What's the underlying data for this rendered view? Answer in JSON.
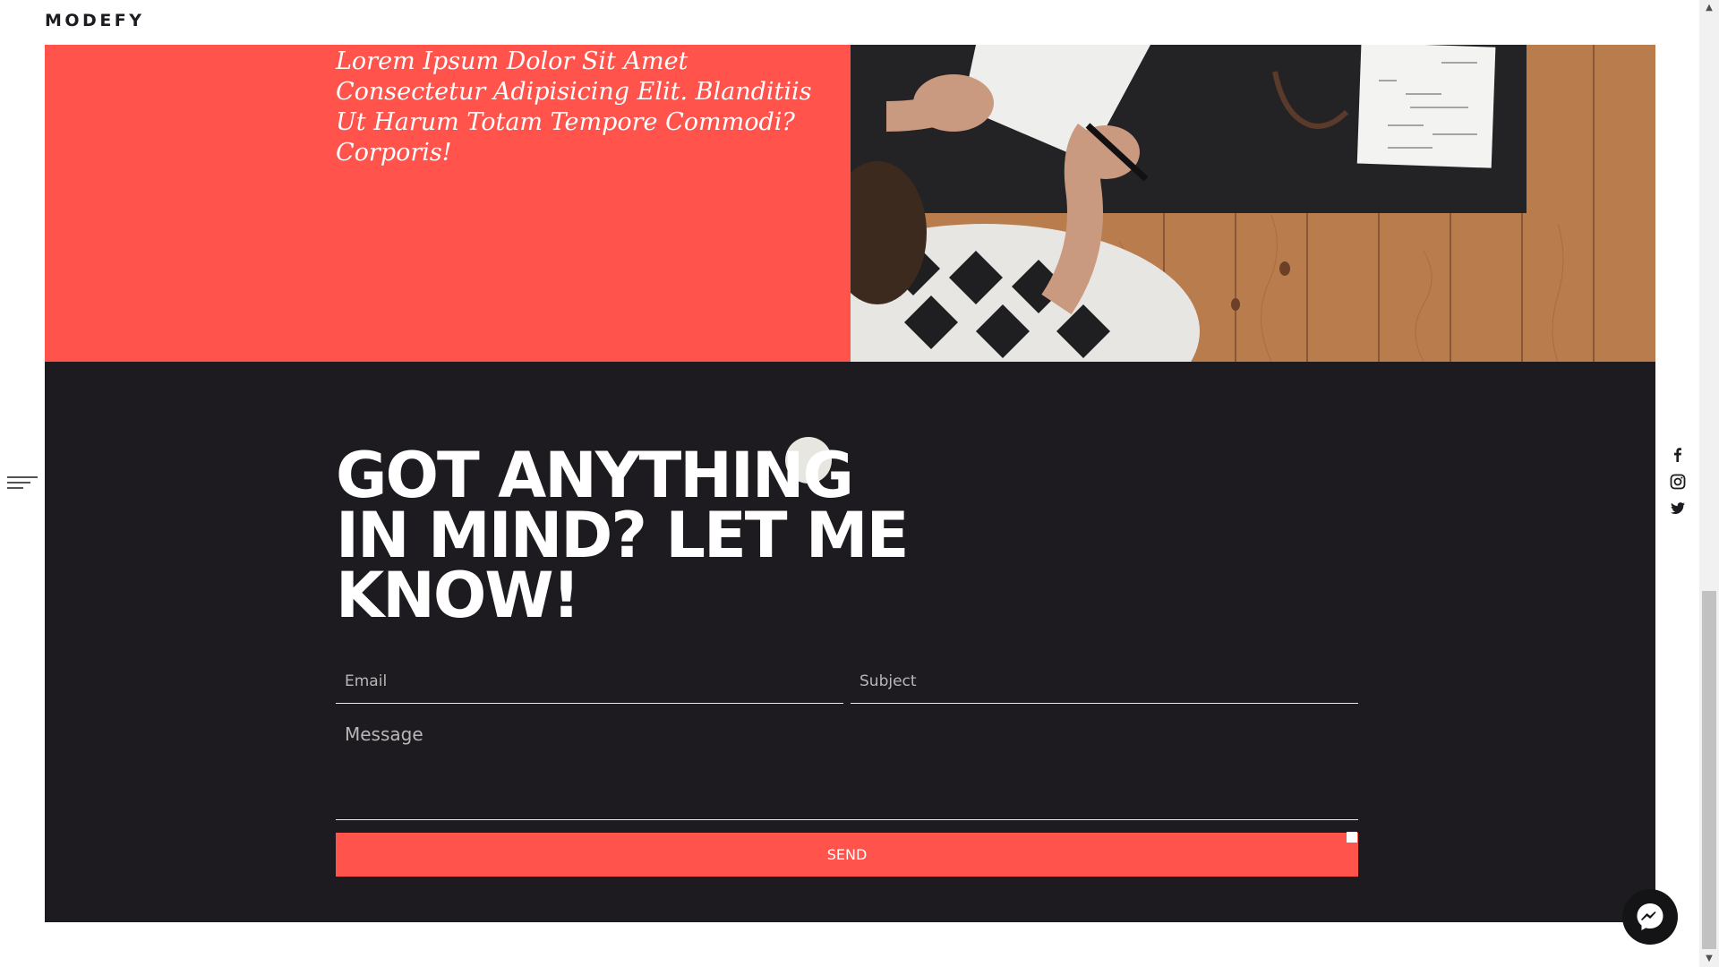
{
  "header": {
    "logo": "MODEFY"
  },
  "hero": {
    "quote": "Lorem Ipsum Dolor Sit Amet Consectetur Adipisicing Elit. Blanditiis Ut Harum Totam Tempore Commodi? Corporis!",
    "accent_color": "#ff534c",
    "image": "person-writing-notebook-photo"
  },
  "contact": {
    "title": "GOT ANYTHING\nIN MIND? LET ME\nKNOW!",
    "email_placeholder": "Email",
    "subject_placeholder": "Subject",
    "message_placeholder": "Message",
    "send_label": "SEND",
    "background_color": "#1d1b20"
  },
  "side_menu": {
    "icon": "menu-lines-icon"
  },
  "social": {
    "items": [
      {
        "icon": "facebook-icon"
      },
      {
        "icon": "instagram-icon"
      },
      {
        "icon": "twitter-icon"
      }
    ]
  },
  "chat": {
    "icon": "messenger-icon"
  }
}
